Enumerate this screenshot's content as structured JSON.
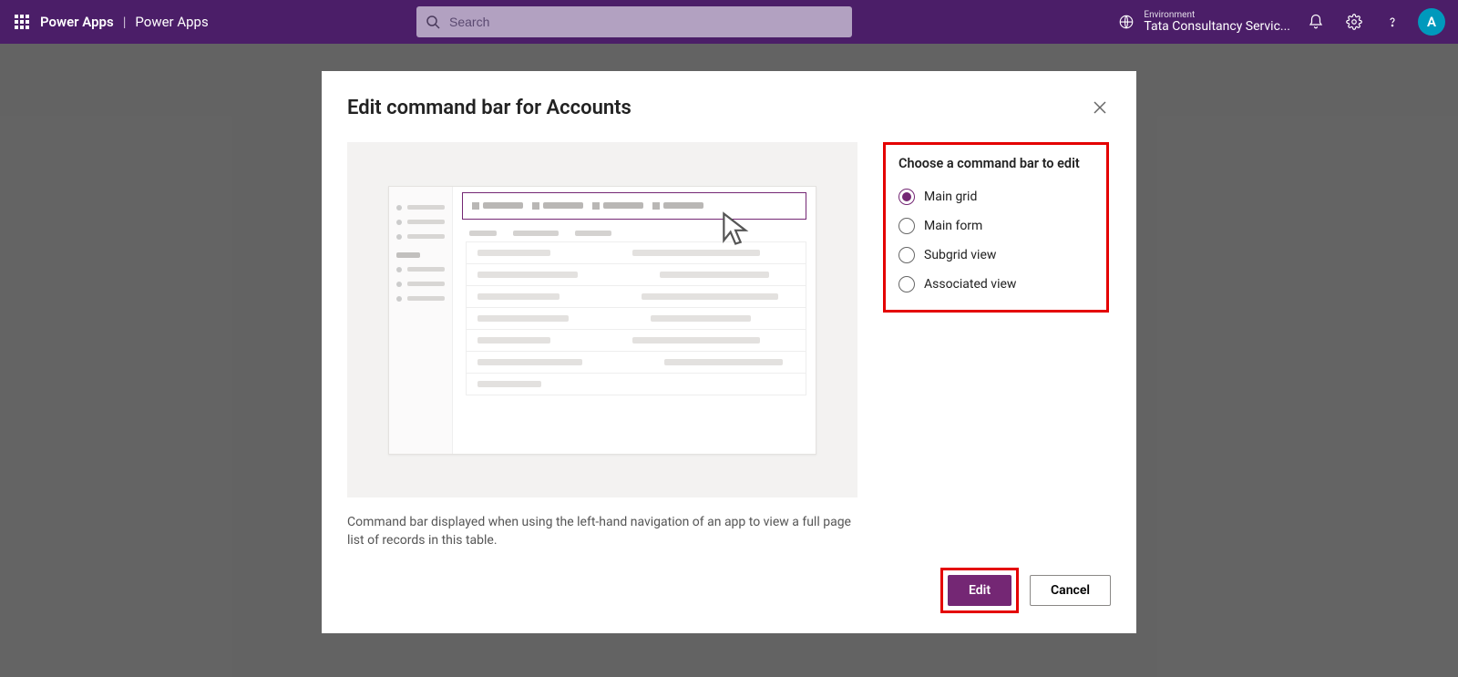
{
  "header": {
    "brand_primary": "Power Apps",
    "brand_secondary": "Power Apps",
    "search_placeholder": "Search",
    "env_label": "Environment",
    "env_value": "Tata Consultancy Servic...",
    "avatar_initial": "A"
  },
  "dialog": {
    "title": "Edit command bar for Accounts",
    "panel_heading": "Choose a command bar to edit",
    "options": [
      {
        "label": "Main grid",
        "selected": true
      },
      {
        "label": "Main form",
        "selected": false
      },
      {
        "label": "Subgrid view",
        "selected": false
      },
      {
        "label": "Associated view",
        "selected": false
      }
    ],
    "description": "Command bar displayed when using the left-hand navigation of an app to view a full page list of records in this table.",
    "primary_button": "Edit",
    "secondary_button": "Cancel"
  }
}
